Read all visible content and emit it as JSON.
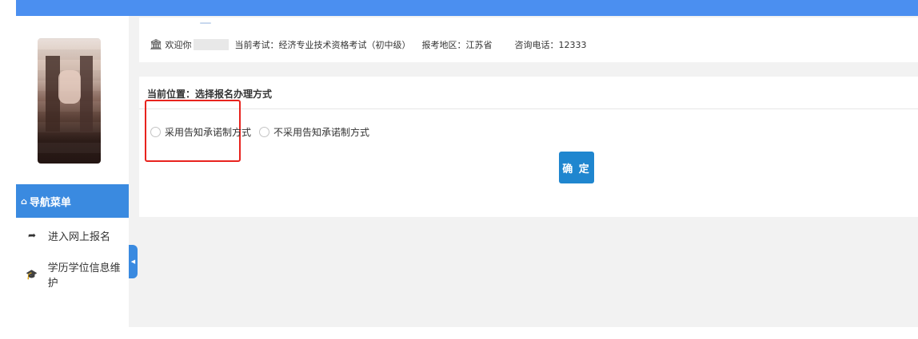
{
  "header": {
    "welcome_label": "欢迎你",
    "exam_label": "当前考试：经济专业技术资格考试（初中级）",
    "region_label": "报考地区：江苏省",
    "phone_label": "咨询电话：12333"
  },
  "sidebar": {
    "nav_title": "导航菜单",
    "items": [
      {
        "label": "进入网上报名",
        "icon": "share-arrow-icon"
      },
      {
        "label": "学历学位信息维护",
        "icon": "graduation-cap-icon"
      }
    ]
  },
  "main": {
    "breadcrumb": "当前位置：选择报名办理方式",
    "options": [
      {
        "label": "采用告知承诺制方式",
        "selected": false
      },
      {
        "label": "不采用告知承诺制方式",
        "selected": false
      }
    ],
    "confirm_label": "确 定"
  },
  "colors": {
    "accent": "#3a8ae0",
    "button": "#1f86cf",
    "highlight": "#e8231e"
  }
}
